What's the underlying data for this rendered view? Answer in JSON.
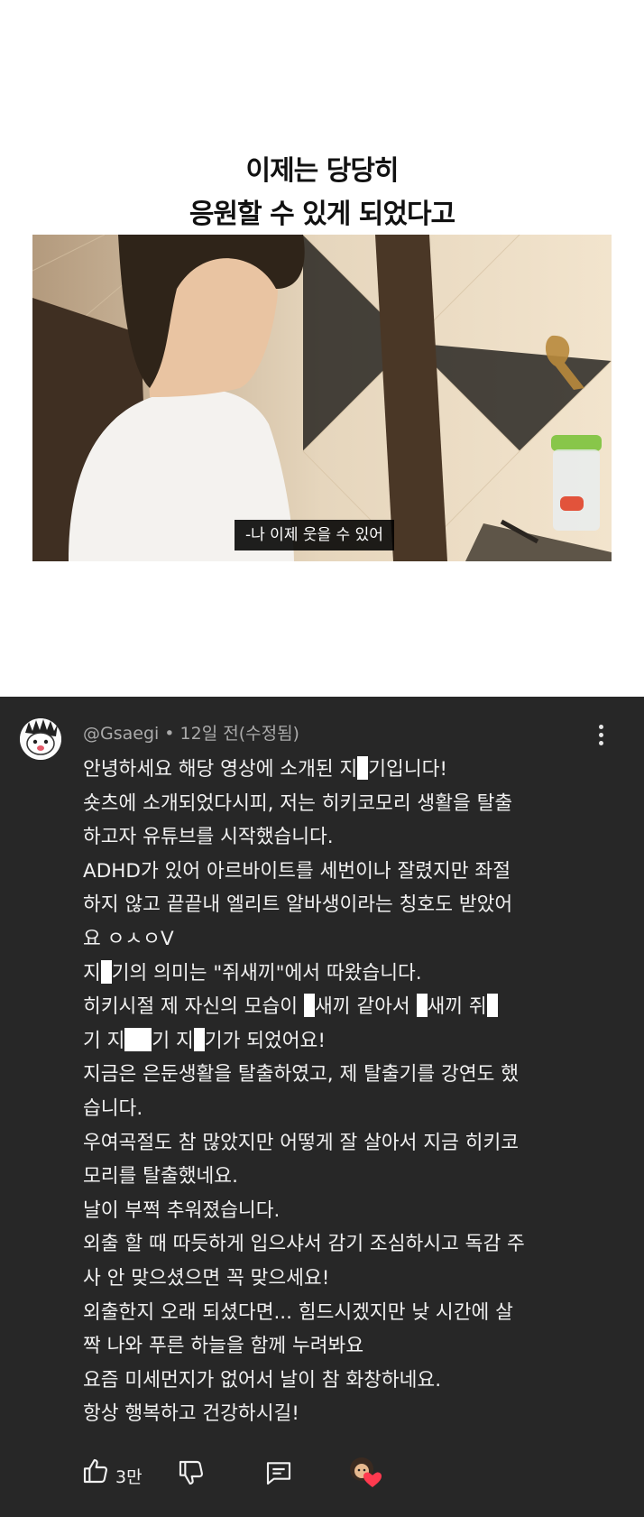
{
  "video": {
    "caption_line1": "이제는 당당히",
    "caption_line2": "응원할 수 있게 되었다고",
    "subtitle": "-나 이제 웃을 수 있어"
  },
  "comment": {
    "author": "@Gsaegi",
    "separator": "•",
    "time": "12일 전(수정됨)",
    "lines": [
      "안녕하세요 해당 영상에 소개된 지",
      "기입니다!",
      "숏츠에 소개되었다시피, 저는 히키코모리 생활을 탈출",
      "하고자 유튜브를 시작했습니다.",
      "ADHD가 있어 아르바이트를 세번이나 잘렸지만 좌절",
      "하지 않고 끝끝내 엘리트 알바생이라는 칭호도 받았어",
      "요 ㅇㅅㅇV",
      "지",
      "기의 의미는 \"쥐새끼\"에서 따왔습니다.",
      "히키시절 제 자신의 모습이",
      "새끼 같아서",
      "새끼 쥐",
      "기 지",
      "기 지",
      "기가 되었어요!",
      "지금은 은둔생활을 탈출하였고, 제 탈출기를 강연도 했",
      "습니다.",
      "우여곡절도 참 많았지만 어떻게 잘 살아서 지금 히키코",
      "모리를 탈출했네요.",
      "날이 부쩍 추워졌습니다.",
      "외출 할 때 따듯하게 입으샤서 감기 조심하시고 독감 주",
      "사 안 맞으셨으면 꼭 맞으세요!",
      "외출한지 오래 되셨다면... 힘드시겠지만 낮 시간에 살",
      "짝 나와 푸른 하늘을 함께 누려봐요",
      "요즘 미세먼지가 없어서 날이 참 화창하네요.",
      "항상 행복하고 건강하시길!"
    ],
    "like_count": "3만"
  },
  "icons": {
    "like": "thumbs-up-icon",
    "dislike": "thumbs-down-icon",
    "reply": "reply-icon",
    "more": "more-vertical-icon",
    "creator_heart": "heart-icon"
  },
  "colors": {
    "comment_bg": "#272727",
    "meta_text": "#aaaaaa",
    "heart": "#ff3a4f"
  }
}
